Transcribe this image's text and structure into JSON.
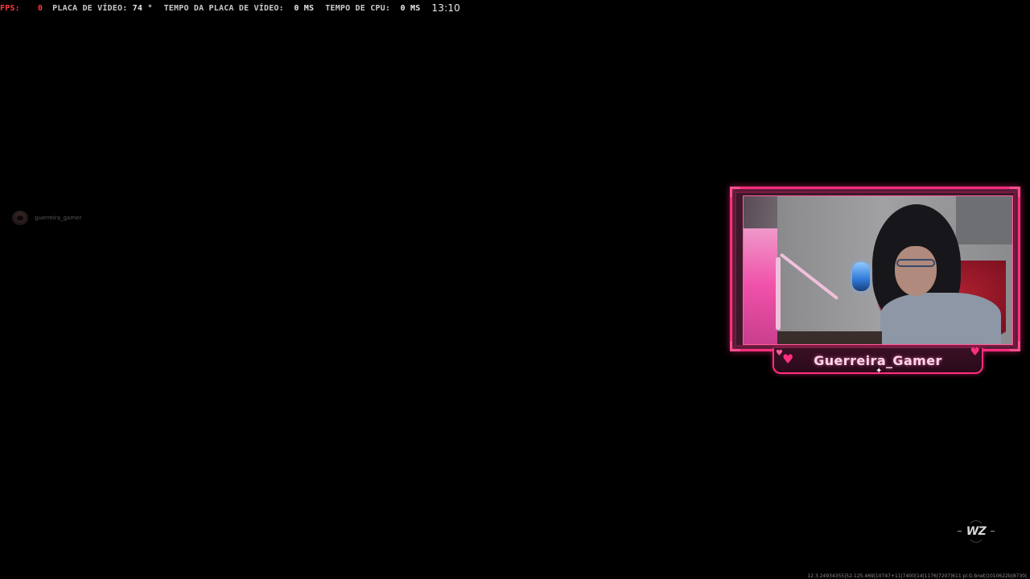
{
  "perf_overlay": {
    "fps_label": "FPS:",
    "fps_value": "0",
    "gpu_label": "PLACA DE VÍDEO:",
    "gpu_value": "74 °",
    "gpu_time_label": "TEMPO DA PLACA DE VÍDEO:",
    "gpu_time_value": "0 MS",
    "cpu_time_label": "TEMPO DE CPU:",
    "cpu_time_value": "0 MS",
    "clock": "13:10",
    "fps_color": "#ff3b3b"
  },
  "chat_user": {
    "username": "guerreira_gamer",
    "avatar_icon": "user-avatar"
  },
  "webcam": {
    "frame_color": "#ff2e7e",
    "streamer_name": "Guerreira_Gamer",
    "decor_icons": [
      "heart-icon",
      "star-icon"
    ]
  },
  "watermark": {
    "text": "WZ"
  },
  "build_info": {
    "version": "12.3.24934355|52-125.469|10747+11|7400|14|1176|7207|611.pl.G.bnet|1010622b|8730|"
  }
}
